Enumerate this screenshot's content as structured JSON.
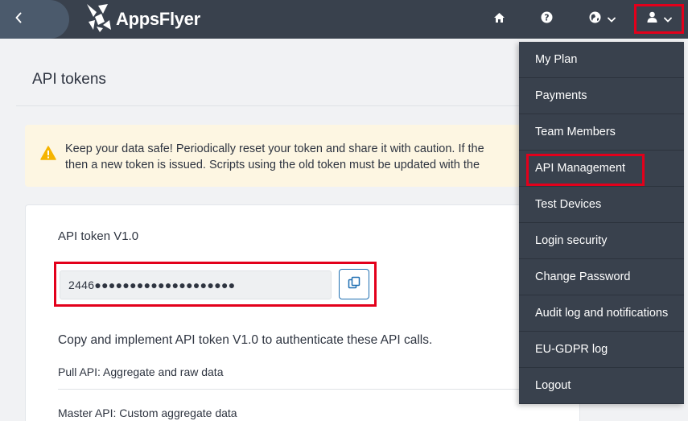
{
  "header": {
    "logo_text": "AppsFlyer",
    "icons": [
      "chevron-left-icon",
      "home-icon",
      "help-icon",
      "globe-icon",
      "user-icon"
    ]
  },
  "page": {
    "title": "API tokens",
    "alert": {
      "line1": "Keep your data safe! Periodically reset your token and share it with caution. If the",
      "line2": "then a new token is issued. Scripts using the old token must be updated with the"
    },
    "token": {
      "title": "API token V1.0",
      "value": "2446●●●●●●●●●●●●●●●●●●●●"
    },
    "description": "Copy and implement API token V1.0 to authenticate these API calls.",
    "api_calls": [
      "Pull API: Aggregate and raw data",
      "Master API: Custom aggregate data"
    ]
  },
  "user_menu": {
    "items": [
      "My Plan",
      "Payments",
      "Team Members",
      "API Management",
      "Test Devices",
      "Login security",
      "Change Password",
      "Audit log and notifications",
      "EU-GDPR log",
      "Logout"
    ]
  },
  "colors": {
    "topbar": "#39414d",
    "highlight": "#e3001b",
    "alert_bg": "#fdf6e2",
    "alert_icon": "#f5b400",
    "copy_accent": "#1f6fb2"
  }
}
